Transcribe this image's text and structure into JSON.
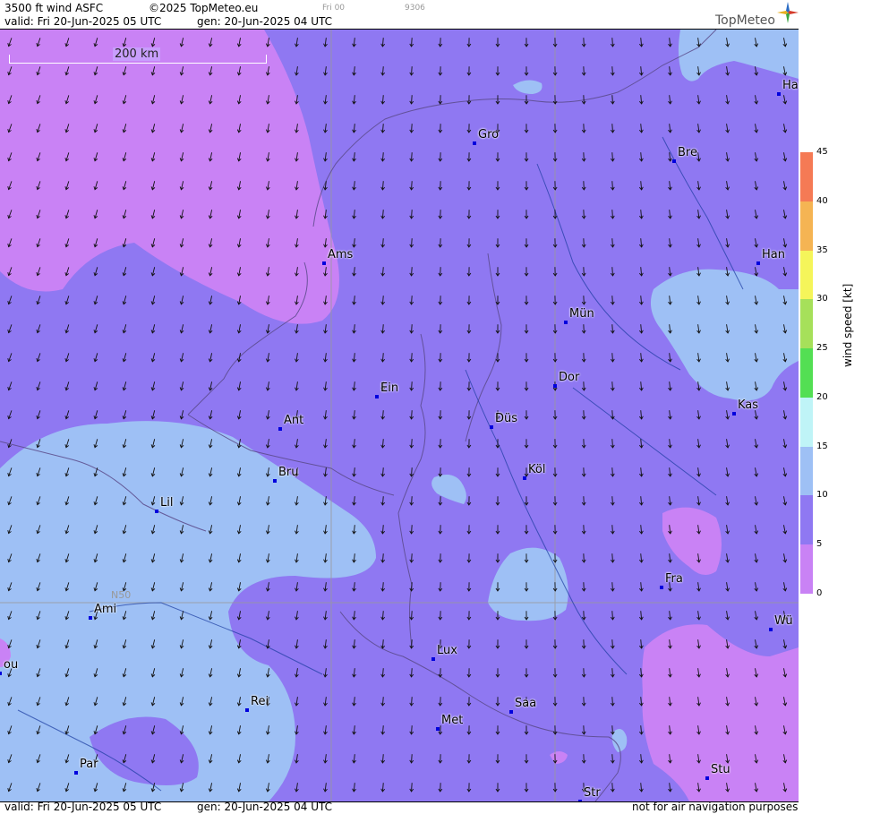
{
  "header": {
    "line1_product": "3500 ft wind ASFC",
    "line1_copyright": "©2025 TopMeteo.eu",
    "line1_run": "Fri 00",
    "line1_code": "9306",
    "line2_valid": "valid:  Fri  20-Jun-2025  05 UTC",
    "line2_gen": "gen:  20-Jun-2025  04 UTC",
    "logo": "TopMeteo"
  },
  "footer": {
    "valid": "valid:  Fri  20-Jun-2025  05 UTC",
    "gen": "gen:  20-Jun-2025  04 UTC",
    "disclaimer": "not for air navigation purposes"
  },
  "map": {
    "scale_label": "200 km",
    "lat_label": "N50",
    "cities": [
      {
        "name": "Ha"
      },
      {
        "name": "Gro"
      },
      {
        "name": "Bre"
      },
      {
        "name": "Ams"
      },
      {
        "name": "Han"
      },
      {
        "name": "Mün"
      },
      {
        "name": "Ein"
      },
      {
        "name": "Dor"
      },
      {
        "name": "Kas"
      },
      {
        "name": "Ant"
      },
      {
        "name": "Düs"
      },
      {
        "name": "Bru"
      },
      {
        "name": "Köl"
      },
      {
        "name": "Lil"
      },
      {
        "name": "Fra"
      },
      {
        "name": "Ami"
      },
      {
        "name": "Wü"
      },
      {
        "name": "Lux"
      },
      {
        "name": "ou"
      },
      {
        "name": "Rei"
      },
      {
        "name": "Saa"
      },
      {
        "name": "Met"
      },
      {
        "name": "Stu"
      },
      {
        "name": "Par"
      },
      {
        "name": "Str"
      }
    ]
  },
  "legend": {
    "title": "wind  speed  [kt]",
    "ticks": [
      "45",
      "40",
      "35",
      "30",
      "25",
      "20",
      "15",
      "10",
      "5",
      "0"
    ],
    "colors": {
      "0-5": "#c982f5",
      "5-10": "#8f78f2",
      "10-15": "#9ec0f5",
      "15-20": "#bff4f7",
      "20-25": "#53df53",
      "25-30": "#a6e05a",
      "30-35": "#f5f55a",
      "35-40": "#f5b453",
      "40-45": "#f57a55"
    }
  }
}
